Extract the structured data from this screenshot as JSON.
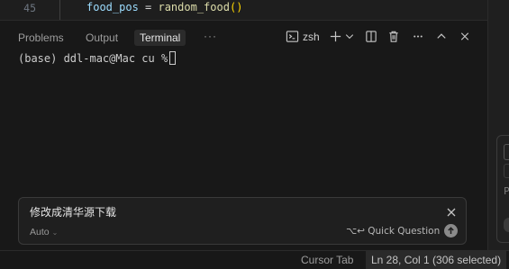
{
  "editor": {
    "line_number": "45",
    "code": {
      "var": "food_pos",
      "op": " = ",
      "fn": "random_food",
      "parens": "()"
    }
  },
  "panel": {
    "tabs": [
      {
        "label": "Problems",
        "active": false
      },
      {
        "label": "Output",
        "active": false
      },
      {
        "label": "Terminal",
        "active": true
      }
    ],
    "more_label": "···",
    "shell_name": "zsh",
    "toolbar_icons": [
      "terminal-icon",
      "plus-icon",
      "chevron-down-icon",
      "split-icon",
      "trash-icon",
      "more-icon",
      "chevron-up-icon",
      "close-icon"
    ]
  },
  "terminal": {
    "prompt": "(base) ddl-mac@Mac cu % "
  },
  "ai_prompt": {
    "text": "修改成清华源下载",
    "mode": "Auto",
    "shortcut": "⌥↩ Quick Question",
    "icons": [
      "close-icon",
      "submit-arrow-icon"
    ]
  },
  "status_bar": {
    "cursor_tab": "Cursor Tab",
    "position": "Ln 28, Col 1 (306 selected)"
  },
  "colors": {
    "background": "#181818",
    "editor_bg": "#1e1e1e",
    "variable": "#9cdcfe",
    "function": "#dcdcaa",
    "paren": "#ffd700"
  }
}
